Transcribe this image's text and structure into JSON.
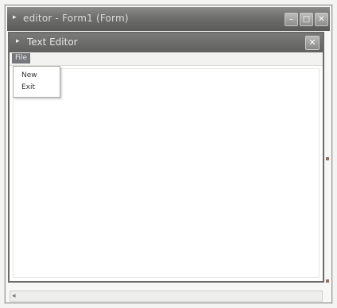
{
  "outer_window": {
    "title": "editor - Form1 (Form)",
    "minimize_glyph": "–",
    "maximize_glyph": "□",
    "close_glyph": "✕"
  },
  "form": {
    "title": "Text Editor",
    "close_glyph": "✕"
  },
  "menubar": {
    "file_label": "File"
  },
  "dropdown": {
    "items": [
      "New",
      "Exit"
    ]
  },
  "icons": {
    "title_arrow": "▸",
    "scroll_left": "◂"
  },
  "colors": {
    "titlebar": "#6e6e6c",
    "selected_menu": "#76777b",
    "handle": "#9b6d5a"
  }
}
